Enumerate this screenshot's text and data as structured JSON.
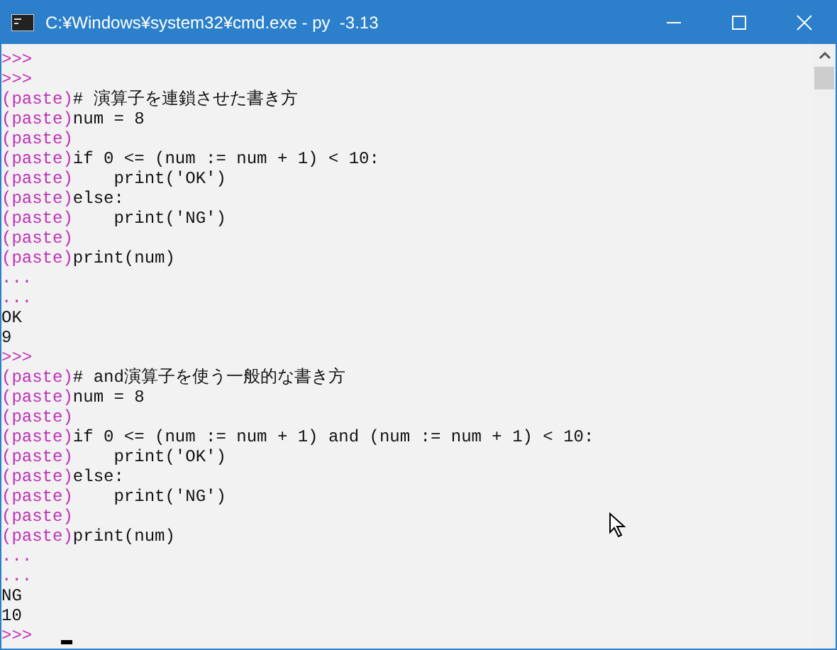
{
  "window": {
    "title": "C:¥Windows¥system32¥cmd.exe - py  -3.13"
  },
  "lines": [
    {
      "prompt": ">>>"
    },
    {
      "prompt": ">>>"
    },
    {
      "prompt": "(paste)",
      "text": "# 演算子を連鎖させた書き方"
    },
    {
      "prompt": "(paste)",
      "text": "num = 8"
    },
    {
      "prompt": "(paste)"
    },
    {
      "prompt": "(paste)",
      "text": "if 0 <= (num := num + 1) < 10:"
    },
    {
      "prompt": "(paste)",
      "text": "    print('OK')"
    },
    {
      "prompt": "(paste)",
      "text": "else:"
    },
    {
      "prompt": "(paste)",
      "text": "    print('NG')"
    },
    {
      "prompt": "(paste)"
    },
    {
      "prompt": "(paste)",
      "text": "print(num)"
    },
    {
      "prompt": "..."
    },
    {
      "prompt": "..."
    },
    {
      "text": "OK"
    },
    {
      "text": "9"
    },
    {
      "prompt": ">>>"
    },
    {
      "prompt": "(paste)",
      "text": "# and演算子を使う一般的な書き方"
    },
    {
      "prompt": "(paste)",
      "text": "num = 8"
    },
    {
      "prompt": "(paste)"
    },
    {
      "prompt": "(paste)",
      "text": "if 0 <= (num := num + 1) and (num := num + 1) < 10:"
    },
    {
      "prompt": "(paste)",
      "text": "    print('OK')"
    },
    {
      "prompt": "(paste)",
      "text": "else:"
    },
    {
      "prompt": "(paste)",
      "text": "    print('NG')"
    },
    {
      "prompt": "(paste)"
    },
    {
      "prompt": "(paste)",
      "text": "print(num)"
    },
    {
      "prompt": "..."
    },
    {
      "prompt": "..."
    },
    {
      "text": "NG"
    },
    {
      "text": "10"
    },
    {
      "prompt": ">>>",
      "cursor": true
    }
  ]
}
